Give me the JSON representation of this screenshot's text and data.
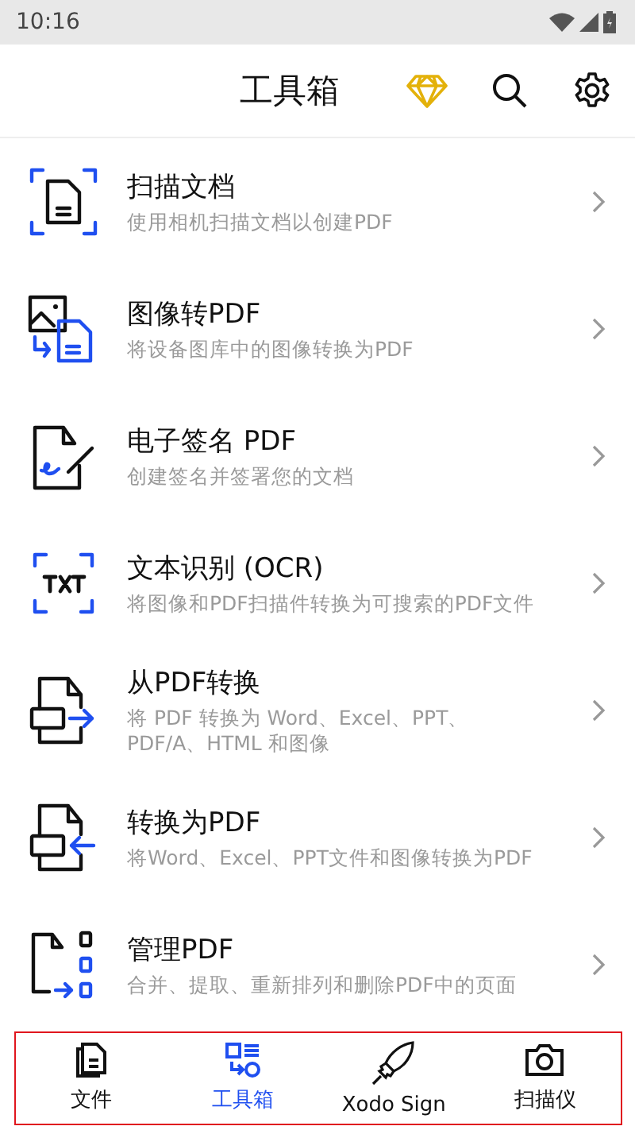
{
  "status_bar": {
    "time": "10:16"
  },
  "header": {
    "title": "工具箱"
  },
  "tools": [
    {
      "title": "扫描文档",
      "description": "使用相机扫描文档以创建PDF"
    },
    {
      "title": "图像转PDF",
      "description": "将设备图库中的图像转换为PDF"
    },
    {
      "title": "电子签名 PDF",
      "description": "创建签名并签署您的文档"
    },
    {
      "title": "文本识别 (OCR)",
      "description": "将图像和PDF扫描件转换为可搜索的PDF文件"
    },
    {
      "title": "从PDF转换",
      "description": "将 PDF 转换为 Word、Excel、PPT、PDF/A、HTML 和图像"
    },
    {
      "title": "转换为PDF",
      "description": "将Word、Excel、PPT文件和图像转换为PDF"
    },
    {
      "title": "管理PDF",
      "description": "合并、提取、重新排列和删除PDF中的页面"
    }
  ],
  "bottom_nav": [
    {
      "label": "文件",
      "selected": false
    },
    {
      "label": "工具箱",
      "selected": true
    },
    {
      "label": "Xodo Sign",
      "selected": false
    },
    {
      "label": "扫描仪",
      "selected": false
    }
  ]
}
